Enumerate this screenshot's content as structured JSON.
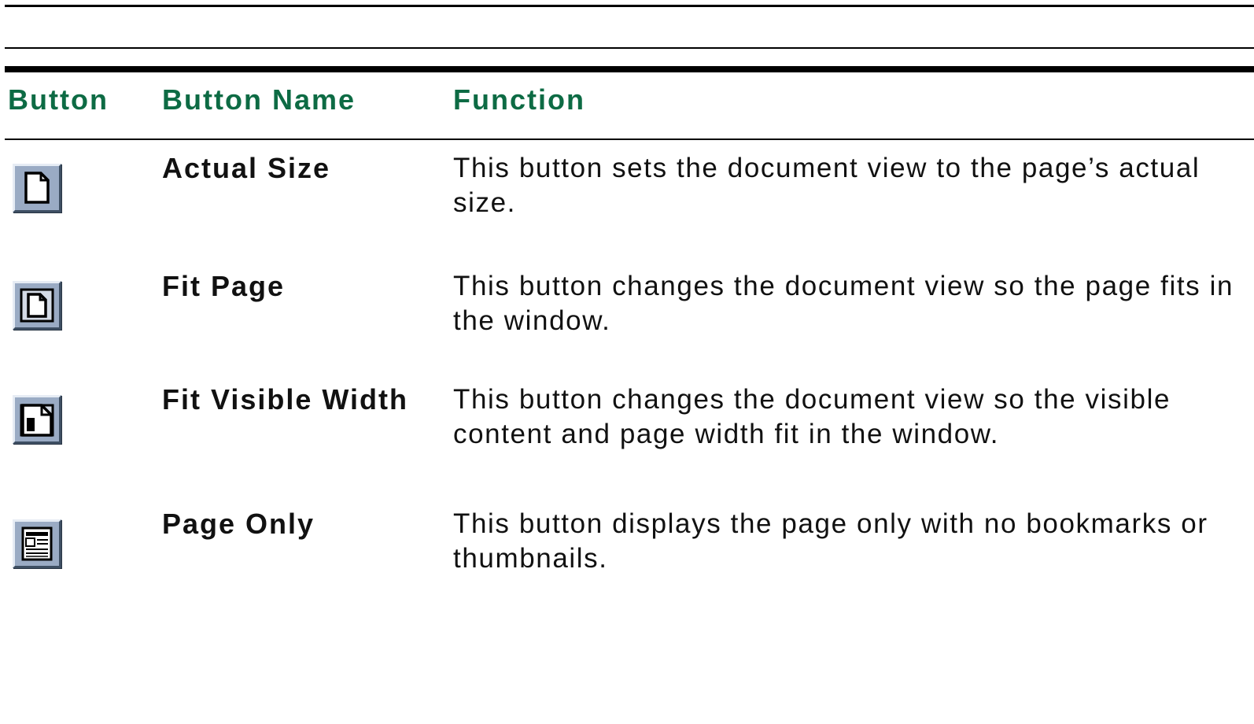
{
  "colors": {
    "header_text": "#0d6b44",
    "rules": "#000000",
    "button_face": "#9aabc4"
  },
  "table": {
    "headers": {
      "button": "Button",
      "button_name": "Button Name",
      "function": "Function"
    },
    "rows": [
      {
        "icon": "actual-size-icon",
        "name": "Actual Size",
        "function": "This button sets the document view to the page’s actual size."
      },
      {
        "icon": "fit-page-icon",
        "name": "Fit Page",
        "function": "This button changes the document view so the page fits in the window."
      },
      {
        "icon": "fit-visible-width-icon",
        "name": "Fit Visible Width",
        "function": "This button changes the document view so the visible content and page width fit in the window."
      },
      {
        "icon": "page-only-icon",
        "name": "Page Only",
        "function": "This button displays the page only with no bookmarks or thumbnails."
      }
    ]
  }
}
